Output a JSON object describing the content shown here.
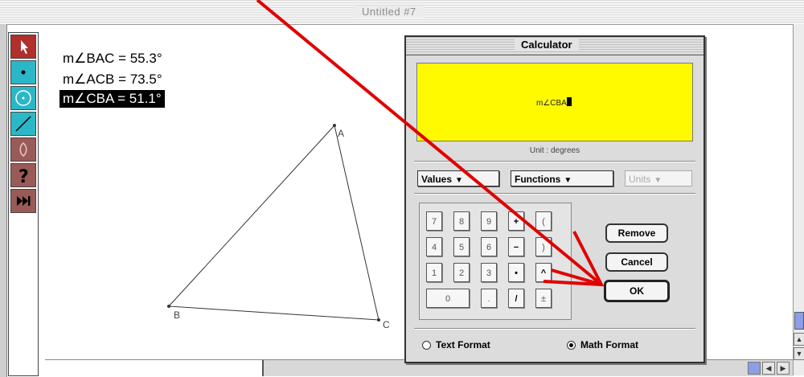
{
  "window": {
    "title": "Untitled #7"
  },
  "toolbox": [
    {
      "name": "arrow-tool",
      "icon": "arrow-icon"
    },
    {
      "name": "point-tool",
      "icon": "point-icon"
    },
    {
      "name": "compass-tool",
      "icon": "circle-icon"
    },
    {
      "name": "straightedge-tool",
      "icon": "line-icon"
    },
    {
      "name": "text-tool",
      "icon": "pencil-icon"
    },
    {
      "name": "info-tool",
      "icon": "question-icon"
    },
    {
      "name": "custom-tool",
      "icon": "fast-forward-icon"
    }
  ],
  "measurements": [
    {
      "text": "m∠BAC = 55.3°",
      "selected": false
    },
    {
      "text": "m∠ACB = 73.5°",
      "selected": false
    },
    {
      "text": "m∠CBA = 51.1°",
      "selected": true
    }
  ],
  "triangle": {
    "labels": [
      "A",
      "B",
      "C"
    ]
  },
  "calculator": {
    "title": "Calculator",
    "expression": "m∠CBA",
    "unit_text": "Unit : degrees",
    "display_color": "#fffa00",
    "menus": {
      "values": "Values",
      "functions": "Functions",
      "units": "Units"
    },
    "keys": [
      [
        "7",
        "8",
        "9",
        "+",
        "("
      ],
      [
        "4",
        "5",
        "6",
        "−",
        ")"
      ],
      [
        "1",
        "2",
        "3",
        "•",
        "^"
      ],
      [
        "0",
        ".",
        "/",
        "±"
      ]
    ],
    "buttons": {
      "remove": "Remove",
      "cancel": "Cancel",
      "ok": "OK"
    },
    "format_options": {
      "text": "Text Format",
      "math": "Math Format",
      "selected": "math"
    }
  },
  "annotation_color": "#e00000"
}
